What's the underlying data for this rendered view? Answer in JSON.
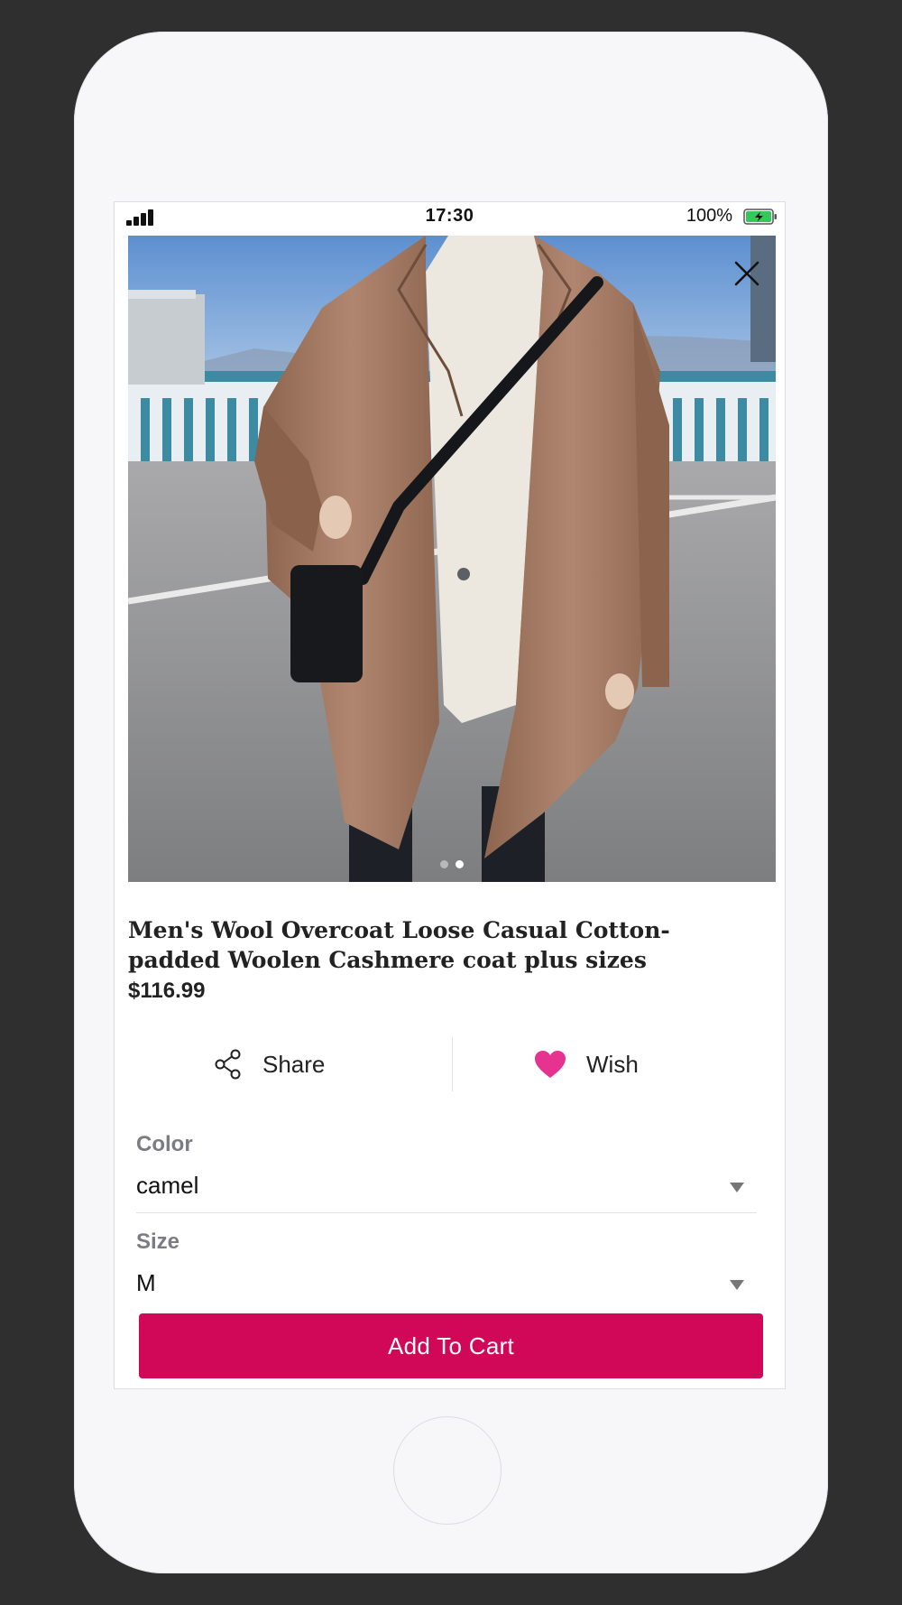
{
  "status_bar": {
    "time": "17:30",
    "battery": "100%"
  },
  "product": {
    "title": "Men's Wool Overcoat Loose Casual Cotton-padded Woolen Cashmere coat plus sizes",
    "price": "$116.99",
    "image_count": 2,
    "image_index": 2
  },
  "actions": {
    "share_label": "Share",
    "wish_label": "Wish"
  },
  "options": {
    "color": {
      "label": "Color",
      "value": "camel"
    },
    "size": {
      "label": "Size",
      "value": "M"
    }
  },
  "cart_button": {
    "label": "Add To Cart"
  },
  "colors": {
    "accent": "#d10757",
    "wish_heart": "#e5338f",
    "battery_fill": "#34c759",
    "coat": "#a3785f"
  },
  "icons": {
    "close": "close-icon",
    "share": "share-icon",
    "wish": "heart-icon",
    "dropdown": "caret-down-icon"
  }
}
